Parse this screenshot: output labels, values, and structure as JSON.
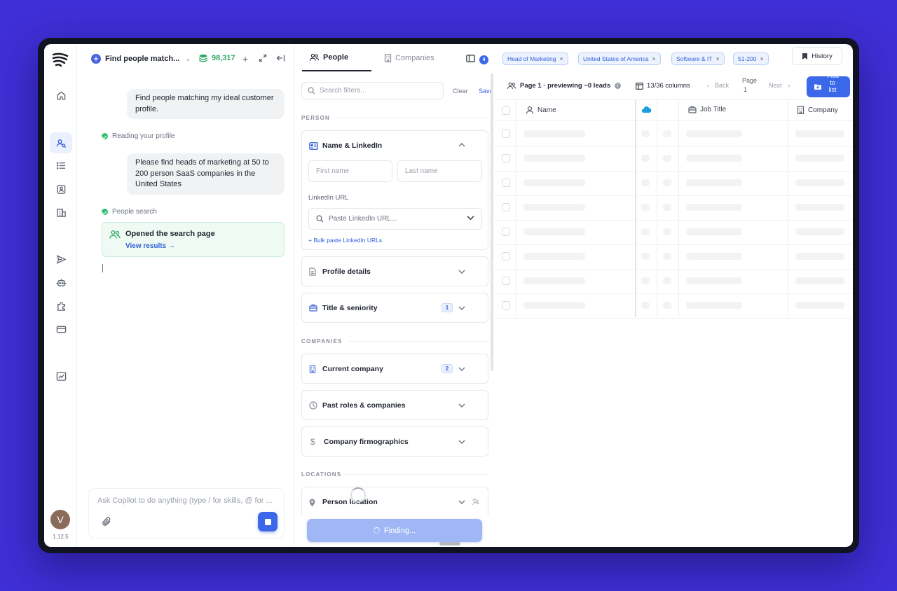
{
  "chat": {
    "title": "Find people match...",
    "credits": "98,317",
    "messages": [
      "Find people matching my ideal customer profile.",
      "Please find heads of marketing at 50 to 200 person SaaS companies in the United States"
    ],
    "status_reading": "Reading your profile",
    "status_search": "People search",
    "result_title": "Opened the search page",
    "result_link": "View results →",
    "composer_placeholder": "Ask Copilot to do anything (type / for skills, @ for ..."
  },
  "rail": {
    "avatar_letter": "V",
    "version": "1.12.5"
  },
  "filters": {
    "tab_people": "People",
    "tab_companies": "Companies",
    "filter_count": "4",
    "search_placeholder": "Search filters...",
    "clear_label": "Clear",
    "save_label": "Save",
    "section_person": "PERSON",
    "section_companies": "COMPANIES",
    "section_locations": "LOCATIONS",
    "name_linkedin": "Name & LinkedIn",
    "first_name_placeholder": "First name",
    "last_name_placeholder": "Last name",
    "linkedin_url_label": "LinkedIn URL",
    "linkedin_placeholder": "Paste LinkedIn URL...",
    "bulk_paste": "+ Bulk paste LinkedIn URLs",
    "profile_details": "Profile details",
    "title_seniority": "Title & seniority",
    "title_count": "1",
    "current_company": "Current company",
    "current_company_count": "2",
    "past_roles": "Past roles & companies",
    "firmographics": "Company firmographics",
    "person_location": "Person location",
    "finding_label": "Finding..."
  },
  "results": {
    "chips": [
      "Head of Marketing",
      "United States of America",
      "Software & IT",
      "51-200"
    ],
    "history_label": "History",
    "page_preview": "Page 1 · previewing ~0 leads",
    "columns_label": "13/36 columns",
    "back_label": "Back",
    "page_label": "Page",
    "page_number": "1",
    "next_label": "Next",
    "add_label_1": "Add",
    "add_label_2": "to",
    "add_label_3": "list",
    "col_name": "Name",
    "col_job_title": "Job Title",
    "col_company": "Company"
  },
  "colors": {
    "accent": "#3a68e8",
    "background": "#3f2fd6",
    "success": "#2fbf71"
  }
}
